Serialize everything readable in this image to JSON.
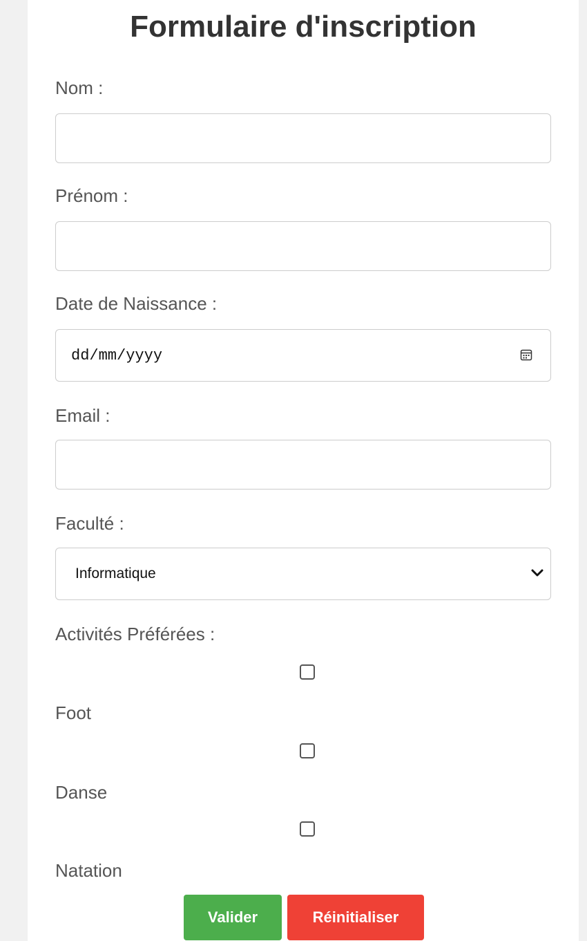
{
  "form": {
    "title": "Formulaire d'inscription",
    "nom_label": "Nom :",
    "nom_value": "",
    "prenom_label": "Prénom :",
    "prenom_value": "",
    "date_label": "Date de Naissance :",
    "date_placeholder": "dd/mm/yyyy",
    "email_label": "Email :",
    "email_value": "",
    "faculte_label": "Faculté :",
    "faculte_selected": "Informatique",
    "activites_label": "Activités Préférées :",
    "activities": [
      {
        "label": "Foot",
        "checked": false
      },
      {
        "label": "Danse",
        "checked": false
      },
      {
        "label": "Natation",
        "checked": false
      }
    ]
  },
  "buttons": {
    "submit_label": "Valider",
    "reset_label": "Réinitialiser"
  },
  "colors": {
    "submit": "#4cae4c",
    "reset": "#ef4136",
    "background": "#f1f1f1"
  }
}
